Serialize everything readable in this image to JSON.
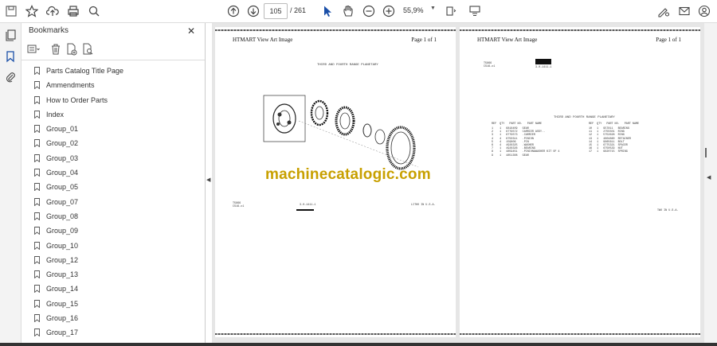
{
  "toolbar": {
    "page_current": "105",
    "page_total": "/ 261",
    "zoom": "55,9%"
  },
  "panel": {
    "title": "Bookmarks",
    "bookmarks": [
      "Parts Catalog Title Page",
      "Ammendments",
      "How to Order Parts",
      "Index",
      "Group_01",
      "Group_02",
      "Group_03",
      "Group_04",
      "Group_05",
      "Group_07",
      "Group_08",
      "Group_09",
      "Group_10",
      "Group_12",
      "Group_13",
      "Group_14",
      "Group_15",
      "Group_16",
      "Group_17"
    ]
  },
  "left_page": {
    "header": "HTMART View Art Image",
    "page_label": "Page 1 of 1",
    "diagram_caption": "THIRD AND FOURTH RANGE PLANETARY",
    "footer_left": "T5866\nCS16-x1",
    "footer_mid": "3-0-1411-1",
    "footer_right": "LITHO IN U.S.A."
  },
  "right_page": {
    "header": "HTMART View Art Image",
    "page_label": "Page 1 of 1",
    "ref_left": "T5866\nCS16-x1",
    "ref_mid": "3-0-1411-1",
    "table_title": "THIRD AND FOURTH RANGE PLANETARY",
    "table_head": "REF  QTY   PART NO.   PART NAME",
    "rows_left": [
      "1    1   6818409   GEAR",
      "2    1   6779572   CARRIER ASSY..",
      "3    1   6779573   .CARRIER",
      "4    4   6750311   .PINION",
      "5    4   159806    .PIN",
      "6    4   4926325   .WASHER",
      "7    1   4926326   .BEARING",
      "8    1   4859451   .PINION&WASHER KIT OF 4",
      "9    1   4851308   GEAR"
    ],
    "rows_right": [
      "10   1   957811   BEARING",
      "11   1   2755501  RING",
      "12   1   5752628  RING",
      "13   1   4804860  RETAINER",
      "14   1   9665611  BOLT",
      "15   1   6775321  SPACER",
      "16   1   6750529  NUT",
      "17   1   6820715  SPRING"
    ],
    "footer_right": "TWO IN U.S.A."
  },
  "watermark": "machinecatalogic.com"
}
